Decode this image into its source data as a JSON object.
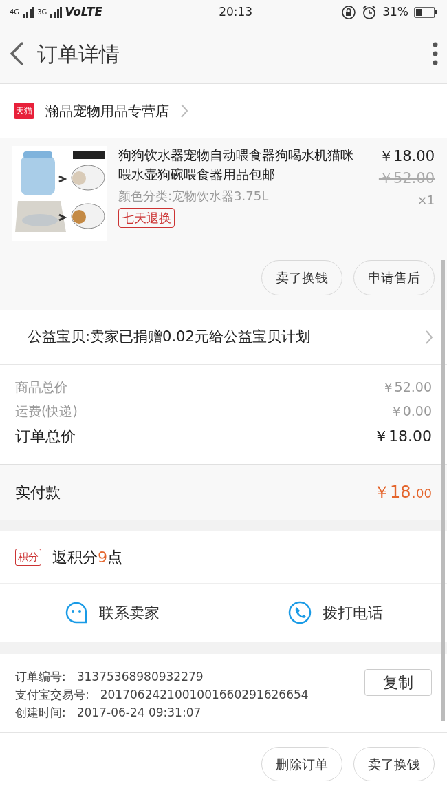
{
  "status_bar": {
    "network_1": "4G",
    "network_2": "3G",
    "volte": "VoLTE",
    "time": "20:13",
    "battery": "31%"
  },
  "header": {
    "title": "订单详情"
  },
  "store": {
    "badge": "天猫",
    "name": "瀚品宠物用品专营店"
  },
  "product": {
    "title": "狗狗饮水器宠物自动喂食器狗喝水机猫咪喂水壶狗碗喂食器用品包邮",
    "variant": "颜色分类:宠物饮水器3.75L",
    "tag": "七天退换",
    "price": "￥18.00",
    "original_price": "￥52.00",
    "quantity": "×1",
    "actions": [
      "卖了换钱",
      "申请售后"
    ]
  },
  "charity": {
    "text": "公益宝贝:卖家已捐赠0.02元给公益宝贝计划"
  },
  "price_rows": [
    {
      "kind": "minor",
      "label": "商品总价",
      "value": "￥52.00"
    },
    {
      "kind": "minor",
      "label": "运费(快递)",
      "value": "￥0.00"
    },
    {
      "kind": "major",
      "label": "订单总价",
      "value": "￥18.00"
    }
  ],
  "payment": {
    "label": "实付款",
    "value_main": "￥18.",
    "value_decimal": "00"
  },
  "points": {
    "tag": "积分",
    "text_before": "返积分",
    "count": "9",
    "text_after": "点"
  },
  "contact": [
    {
      "kind": "chat",
      "label": "联系卖家"
    },
    {
      "kind": "phone",
      "label": "拨打电话"
    }
  ],
  "order_info": {
    "rows": [
      {
        "label": "订单编号:",
        "value": "31375368980932279"
      },
      {
        "label": "支付宝交易号:",
        "value": "2017062421001001660291626654"
      },
      {
        "label": "创建时间:",
        "value": "2017-06-24 09:31:07"
      }
    ],
    "copy_button": "复制"
  },
  "footer_buttons": [
    "删除订单",
    "卖了换钱"
  ]
}
